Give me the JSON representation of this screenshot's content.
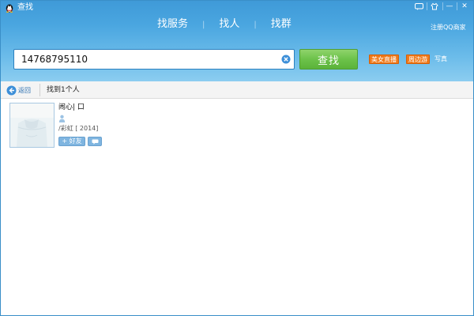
{
  "window": {
    "title": "查找",
    "controls": {
      "feedback": "feedback-icon",
      "skin": "skin-icon",
      "minimize": "—",
      "close": "✕"
    }
  },
  "tabs": [
    {
      "label": "找服务",
      "active": true
    },
    {
      "label": "找人",
      "active": false
    },
    {
      "label": "找群",
      "active": false
    }
  ],
  "header": {
    "register_link": "注册QQ商家"
  },
  "search": {
    "value": "14768795110",
    "placeholder": "",
    "button_label": "查找"
  },
  "quick_links": {
    "tag_beauty": "美女直播",
    "tag_around": "周边游",
    "photo": "写真"
  },
  "results_bar": {
    "back_label": "返回",
    "count_text": "找到1个人"
  },
  "results": [
    {
      "nickname": "闹心| 口",
      "location": "/彩虹 [ 2014]",
      "add_friend_label": "+ 好友"
    }
  ],
  "colors": {
    "header_top": "#3f9ad8",
    "header_bottom": "#8ccdf0",
    "search_button": "#6cc24a",
    "tag_orange": "#f07a1a",
    "link_blue": "#2a6fb0"
  }
}
